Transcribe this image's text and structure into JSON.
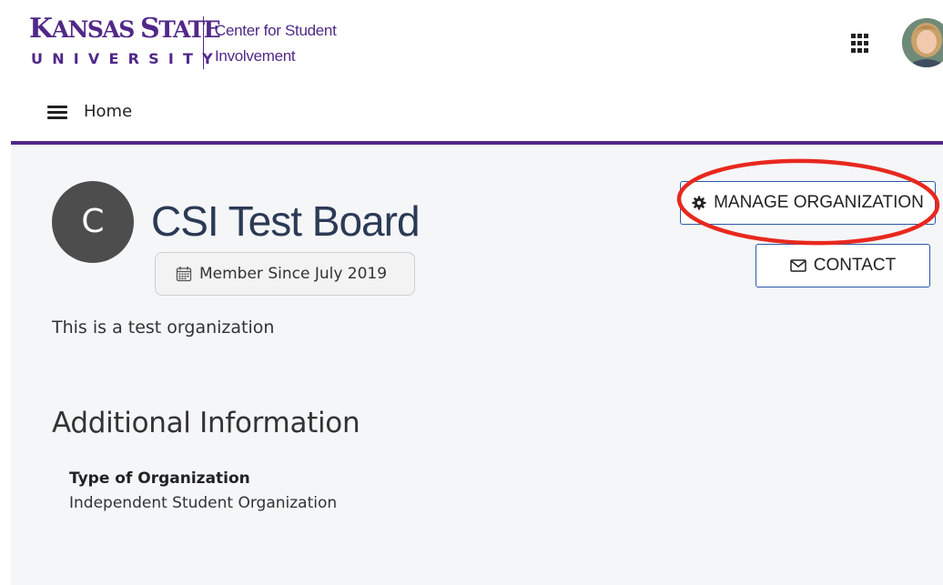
{
  "header": {
    "logo": {
      "line1_cap1": "K",
      "line1_rest1": "ANSAS ",
      "line1_cap2": "S",
      "line1_rest2": "TATE",
      "line2": "UNIVERSITY",
      "sub_line1": "Center for Student",
      "sub_line2": "Involvement"
    },
    "apps_icon": "apps-grid-icon",
    "avatar_icon": "user-avatar"
  },
  "nav": {
    "menu_icon": "hamburger-menu-icon",
    "home_label": "Home"
  },
  "organization": {
    "initial": "C",
    "name": "CSI Test Board",
    "member_since": "Member Since July 2019",
    "description": "This is a test organization"
  },
  "actions": {
    "manage_label": "MANAGE ORGANIZATION",
    "contact_label": "CONTACT"
  },
  "additional_info": {
    "title": "Additional Information",
    "type_label": "Type of Organization",
    "type_value": "Independent Student Organization"
  },
  "colors": {
    "brand_purple": "#512888",
    "org_name": "#2b3a55",
    "button_border": "#2b59a8",
    "annotation_red": "#e8281e"
  }
}
